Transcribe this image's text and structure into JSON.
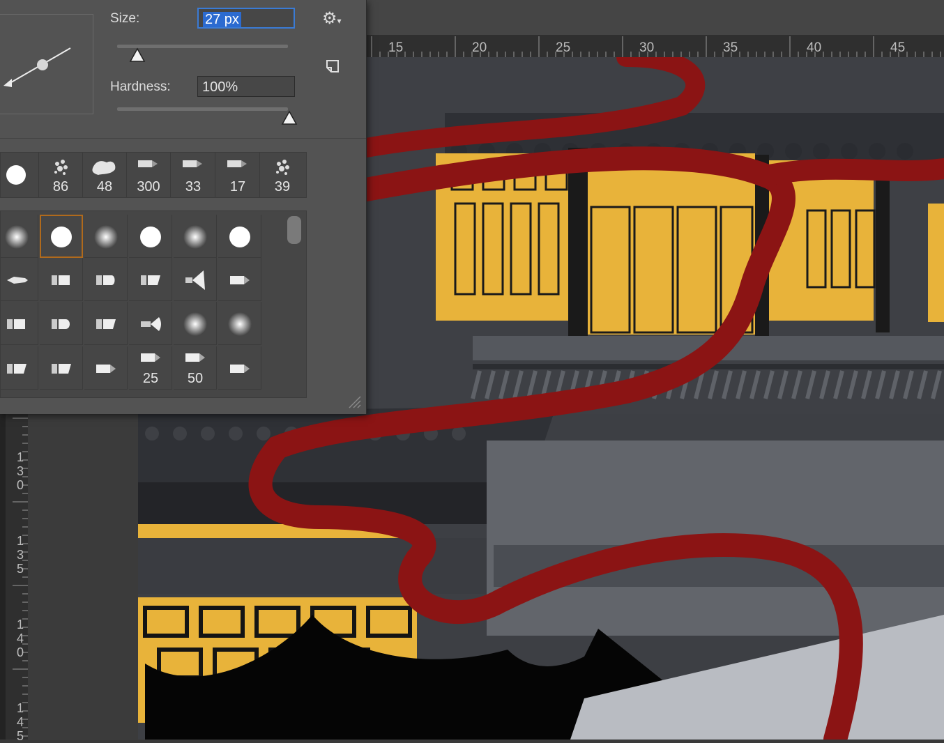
{
  "brush_panel": {
    "size_label": "Size:",
    "size_value": "27 px",
    "size_slider_fraction": 0.1,
    "hardness_label": "Hardness:",
    "hardness_value": "100%",
    "hardness_slider_fraction": 1.0,
    "gear_icon": "gear-icon",
    "new_preset_icon": "new-preset-icon",
    "recent_brushes": [
      {
        "num": "",
        "icon": "hard-round-icon"
      },
      {
        "num": "86",
        "icon": "spatter-icon"
      },
      {
        "num": "48",
        "icon": "chalk-icon"
      },
      {
        "num": "300",
        "icon": "tip-brush-icon"
      },
      {
        "num": "33",
        "icon": "tip-brush-icon"
      },
      {
        "num": "17",
        "icon": "tip-brush-icon"
      },
      {
        "num": "39",
        "icon": "spatter-icon"
      }
    ],
    "preset_rows": [
      [
        "soft-round",
        "hard-round",
        "soft-round",
        "hard-round",
        "soft-round",
        "hard-round"
      ],
      [
        "brush-tip",
        "flat-brush",
        "flat-brush",
        "angled-brush",
        "fan-brush",
        "pencil-tip"
      ],
      [
        "flat-brush",
        "round-brush",
        "angled-brush",
        "airbrush",
        "soft-round",
        "soft-round"
      ],
      [
        "angled-brush",
        "angled-brush",
        "pencil-tip",
        "pencil-tip",
        "pencil-tip",
        "pencil-tip"
      ]
    ],
    "preset_numbers_last_row": [
      "",
      "",
      "",
      "25",
      "50",
      ""
    ],
    "selected_preset": "hard-round"
  },
  "ruler": {
    "horizontal_labels": [
      "15",
      "20",
      "25",
      "30",
      "35",
      "40",
      "45"
    ],
    "vertical_labels": [
      "130",
      "135",
      "140",
      "145"
    ]
  },
  "colors": {
    "panel_bg": "#535353",
    "selection_blue": "#2c6bd0",
    "selected_outline": "#b06a1c",
    "ribbon_red": "#8b1414",
    "window_gold": "#e8b33a"
  }
}
